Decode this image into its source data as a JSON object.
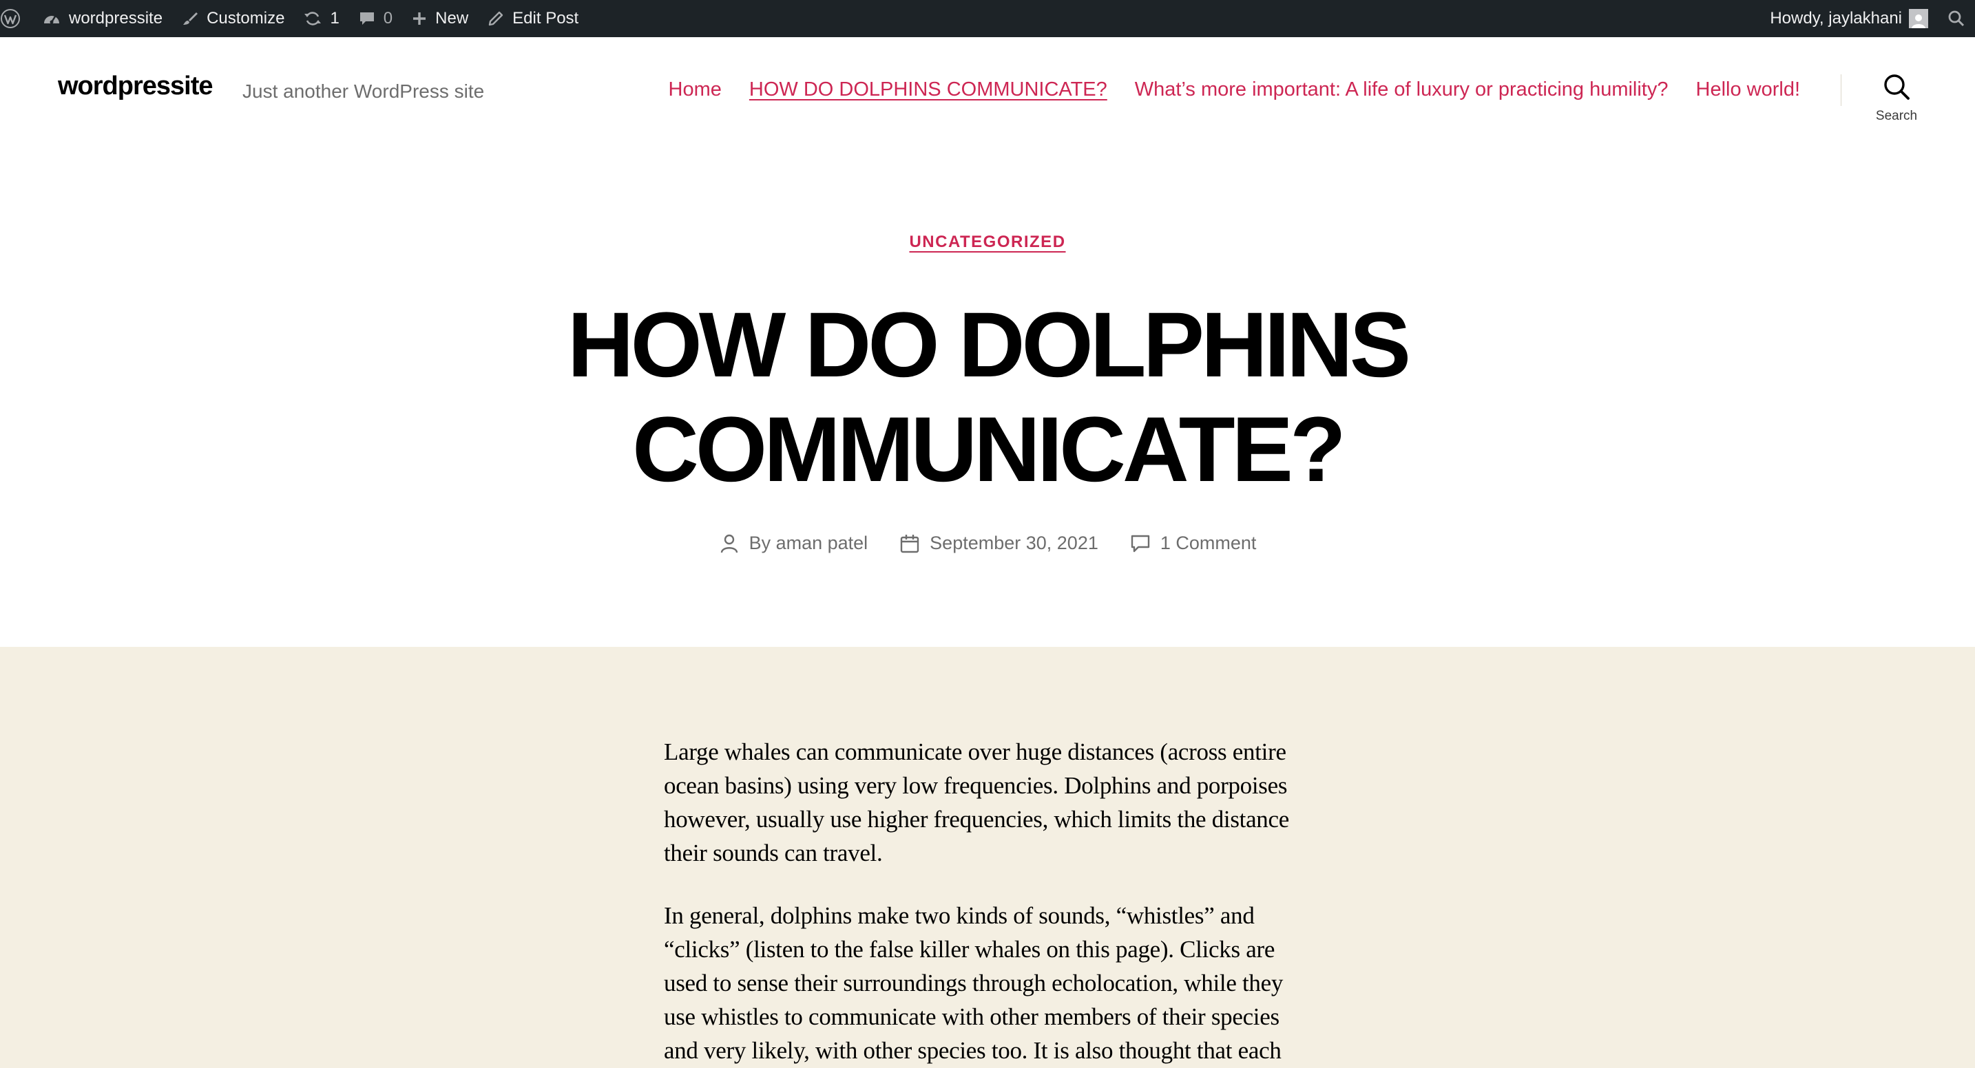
{
  "admin_bar": {
    "site_name": "wordpressite",
    "customize_label": "Customize",
    "updates_count": "1",
    "comments_count": "0",
    "new_label": "New",
    "edit_post_label": "Edit Post",
    "greeting": "Howdy, jaylakhani",
    "icons": [
      "wordpress-logo-icon",
      "dashboard-icon",
      "brush-icon",
      "updates-icon",
      "comment-bubble-icon",
      "plus-icon",
      "pencil-icon",
      "search-icon"
    ]
  },
  "header": {
    "site_title": "wordpressite",
    "site_description": "Just another WordPress site",
    "nav": [
      {
        "label": "Home"
      },
      {
        "label": "HOW DO DOLPHINS COMMUNICATE?"
      },
      {
        "label": "What’s more important: A life of luxury or practicing humility?"
      },
      {
        "label": "Hello world!"
      }
    ],
    "search_label": "Search"
  },
  "post": {
    "category": "UNCATEGORIZED",
    "title": "HOW DO DOLPHINS COMMUNICATE?",
    "author": "By aman patel",
    "date": "September 30, 2021",
    "comments": "1 Comment",
    "paragraphs": [
      "Large whales can communicate over huge distances (across entire ocean basins) using very low frequencies. Dolphins and porpoises however, usually use higher frequencies, which limits the distance their sounds can travel.",
      "In general, dolphins make two kinds of sounds, “whistles” and “clicks” (listen to the false killer whales on this page). Clicks are used to sense their surroundings through echolocation, while they use whistles to communicate with other members of their species and very likely, with other species too. It is also thought that each"
    ]
  },
  "colors": {
    "admin_bar_bg": "#1d2327",
    "accent": "#cd2653",
    "content_bg": "#f4efe2",
    "meta_text": "#6d6d6d"
  }
}
